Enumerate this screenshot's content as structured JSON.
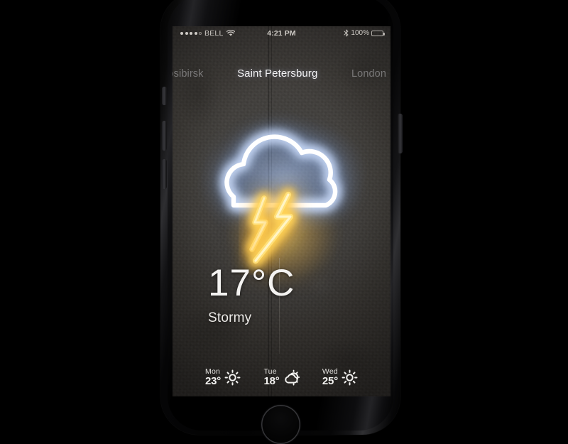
{
  "device": {
    "name": "iphone-black",
    "home_button": "home-button"
  },
  "status_bar": {
    "signal_dots_filled": 4,
    "signal_dots_total": 5,
    "carrier": "BELL",
    "wifi_icon": "wifi-icon",
    "time": "4:21 PM",
    "bluetooth_icon": "bluetooth-icon",
    "battery_percent": "100%",
    "battery_icon": "battery-full-icon"
  },
  "city_tabs": [
    {
      "label": "ovosibirsk",
      "active": false
    },
    {
      "label": "Saint Petersburg",
      "active": true
    },
    {
      "label": "London",
      "active": false
    }
  ],
  "hero": {
    "icon": "neon-cloud-lightning-icon",
    "cloud_color": "#ffffff",
    "cloud_glow_color": "#9db6e8",
    "bolt_color": "#ffd95e",
    "bolt_glow_color": "#ffc341"
  },
  "current": {
    "temperature": "17°C",
    "condition": "Stormy"
  },
  "forecast": [
    {
      "day": "Mon",
      "temp": "23°",
      "icon": "sun-icon"
    },
    {
      "day": "Tue",
      "temp": "18°",
      "icon": "sun-behind-cloud-icon"
    },
    {
      "day": "Wed",
      "temp": "25°",
      "icon": "sun-icon"
    }
  ],
  "colors": {
    "background": "#000000",
    "screen_wall": "#3c3935",
    "text_primary": "#f4f3f1",
    "text_muted": "#6d6d72",
    "neon_white": "#ffffff",
    "neon_yellow": "#ffd95e"
  }
}
